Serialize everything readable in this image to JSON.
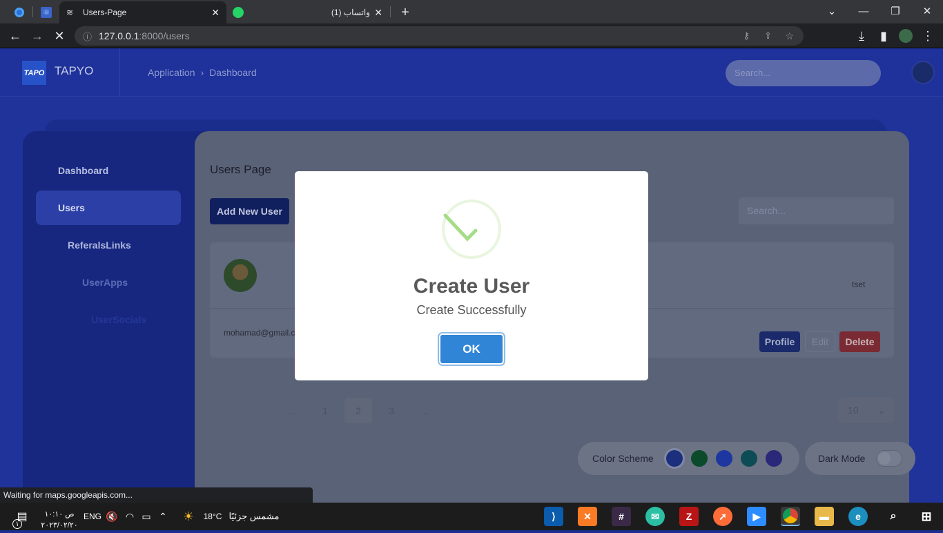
{
  "browser": {
    "tabs": [
      {
        "label": "",
        "icon": "edge-icon",
        "pinned": true
      },
      {
        "label": "",
        "icon": "react-icon",
        "pinned": true
      },
      {
        "label": "Users-Page",
        "icon": "stack-icon",
        "active": true
      },
      {
        "label": "(1) واتساب",
        "icon": "whatsapp-icon"
      }
    ],
    "new_tab": "+",
    "url_host": "127.0.0.1",
    "url_path": ":8000/users",
    "status": "Waiting for maps.googleapis.com..."
  },
  "app": {
    "brand": "TAPYO",
    "logo_text": "TAPO",
    "breadcrumb": [
      "Application",
      "Dashboard"
    ],
    "search_placeholder": "Search...",
    "sidebar": [
      "Dashboard",
      "Users",
      "ReferalsLinks",
      "UserApps",
      "UserSocials"
    ],
    "page_title": "Users Page",
    "add_button": "Add New User",
    "list_search_placeholder": "Search...",
    "user": {
      "name": "tset",
      "email": "mohamad@gmail.com"
    },
    "actions": [
      "Profile",
      "Edit",
      "Delete"
    ],
    "pagination": [
      "...",
      "1",
      "2",
      "3",
      "..."
    ],
    "active_page": "2",
    "page_size": "10",
    "color_scheme_label": "Color Scheme",
    "scheme_colors": [
      "#1b2f7c",
      "#0b4a2a",
      "#1d36a0",
      "#0e4c55",
      "#2a2878"
    ],
    "dark_mode_label": "Dark Mode"
  },
  "modal": {
    "title": "Create User",
    "text": "Create Successfully",
    "ok": "OK",
    "accent": "#3085d6",
    "success_color": "#a5dc86"
  },
  "taskbar": {
    "time": "۱۰:۱۰ ص",
    "date": "۲۰۲۳/۰۲/۲۰",
    "lang": "ENG",
    "weather_temp": "18°C",
    "weather_text": "مشمس جزئيًا",
    "notif_count": "۱"
  }
}
